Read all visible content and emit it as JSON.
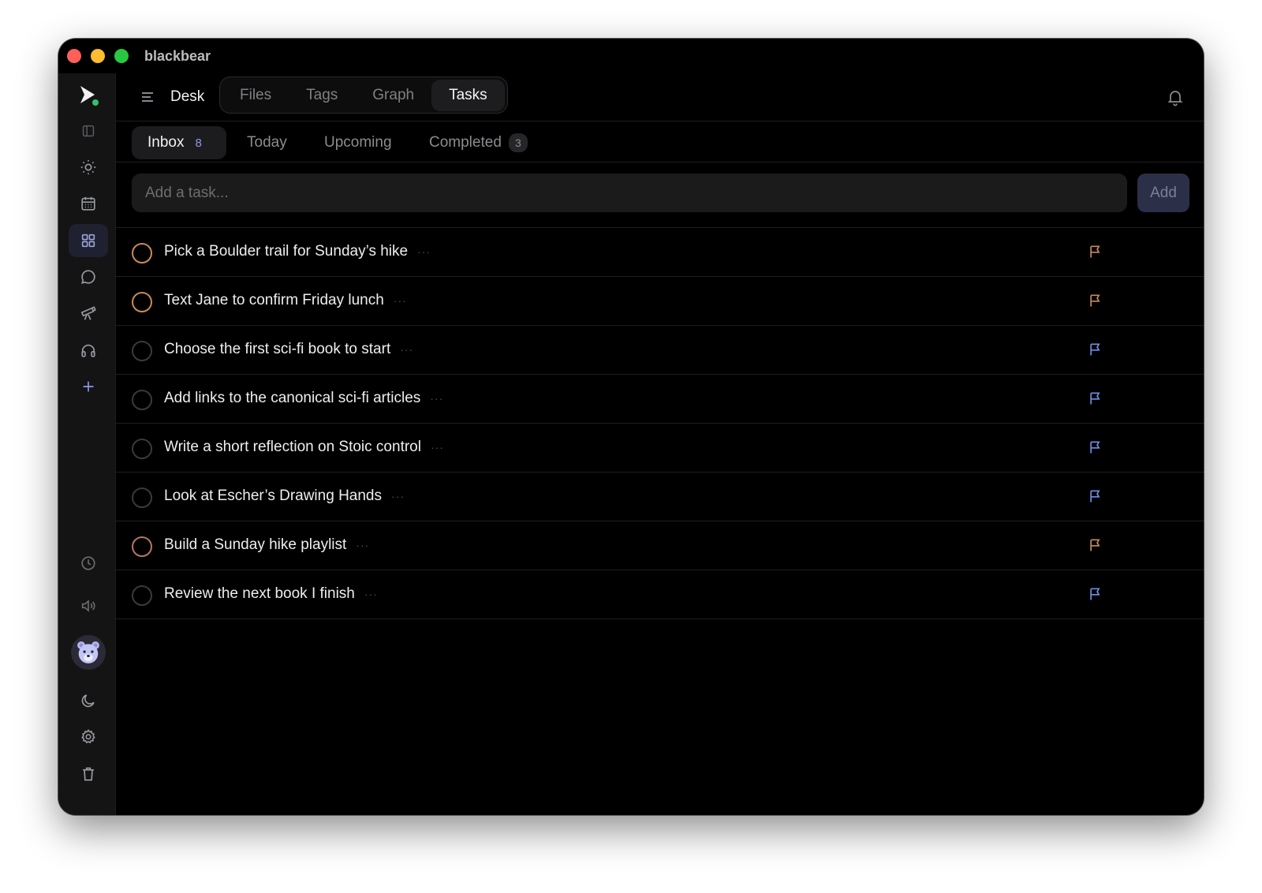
{
  "app": {
    "title": "blackbear"
  },
  "sidebar": {
    "items": [
      {
        "icon": "logo-icon"
      },
      {
        "icon": "panel-toggle-icon"
      },
      {
        "icon": "sun-icon"
      },
      {
        "icon": "calendar-icon"
      },
      {
        "icon": "grid-icon",
        "active": true
      },
      {
        "icon": "chat-icon"
      },
      {
        "icon": "telescope-icon"
      },
      {
        "icon": "headphones-icon"
      },
      {
        "icon": "plus-icon"
      },
      {
        "icon": "clock-icon"
      },
      {
        "icon": "speaker-icon"
      },
      {
        "icon": "bear-avatar-icon"
      },
      {
        "icon": "moon-icon"
      },
      {
        "icon": "gear-icon"
      },
      {
        "icon": "trash-icon"
      }
    ]
  },
  "topnav": {
    "desk_label": "Desk",
    "tabs": [
      {
        "label": "Files"
      },
      {
        "label": "Tags"
      },
      {
        "label": "Graph"
      },
      {
        "label": "Tasks",
        "active": true
      }
    ]
  },
  "subtabs": {
    "inbox": {
      "label": "Inbox",
      "count": "8"
    },
    "today": {
      "label": "Today"
    },
    "upcoming": {
      "label": "Upcoming"
    },
    "completed": {
      "label": "Completed",
      "count": "3"
    }
  },
  "add_task": {
    "placeholder": "Add a task...",
    "value": "",
    "button_label": "Add"
  },
  "colors": {
    "priority_high": "#c98a58",
    "priority_low": "#6f8ee8",
    "accent": "#8f96e8"
  },
  "tasks": [
    {
      "text": "Pick a Boulder trail for Sunday’s hike",
      "priority": "high",
      "more": "···"
    },
    {
      "text": "Text Jane to confirm Friday lunch",
      "priority": "high",
      "more": "···"
    },
    {
      "text": "Choose the first sci-fi book to start",
      "priority": "low",
      "more": "···"
    },
    {
      "text": "Add links to the canonical sci-fi articles",
      "priority": "low",
      "more": "···"
    },
    {
      "text": "Write a short reflection on Stoic control",
      "priority": "low",
      "more": "···"
    },
    {
      "text": "Look at Escher’s Drawing Hands",
      "priority": "low",
      "more": "···"
    },
    {
      "text": "Build a Sunday hike playlist",
      "priority": "mid",
      "more": "···"
    },
    {
      "text": "Review the next book I finish",
      "priority": "low",
      "more": "···"
    }
  ]
}
